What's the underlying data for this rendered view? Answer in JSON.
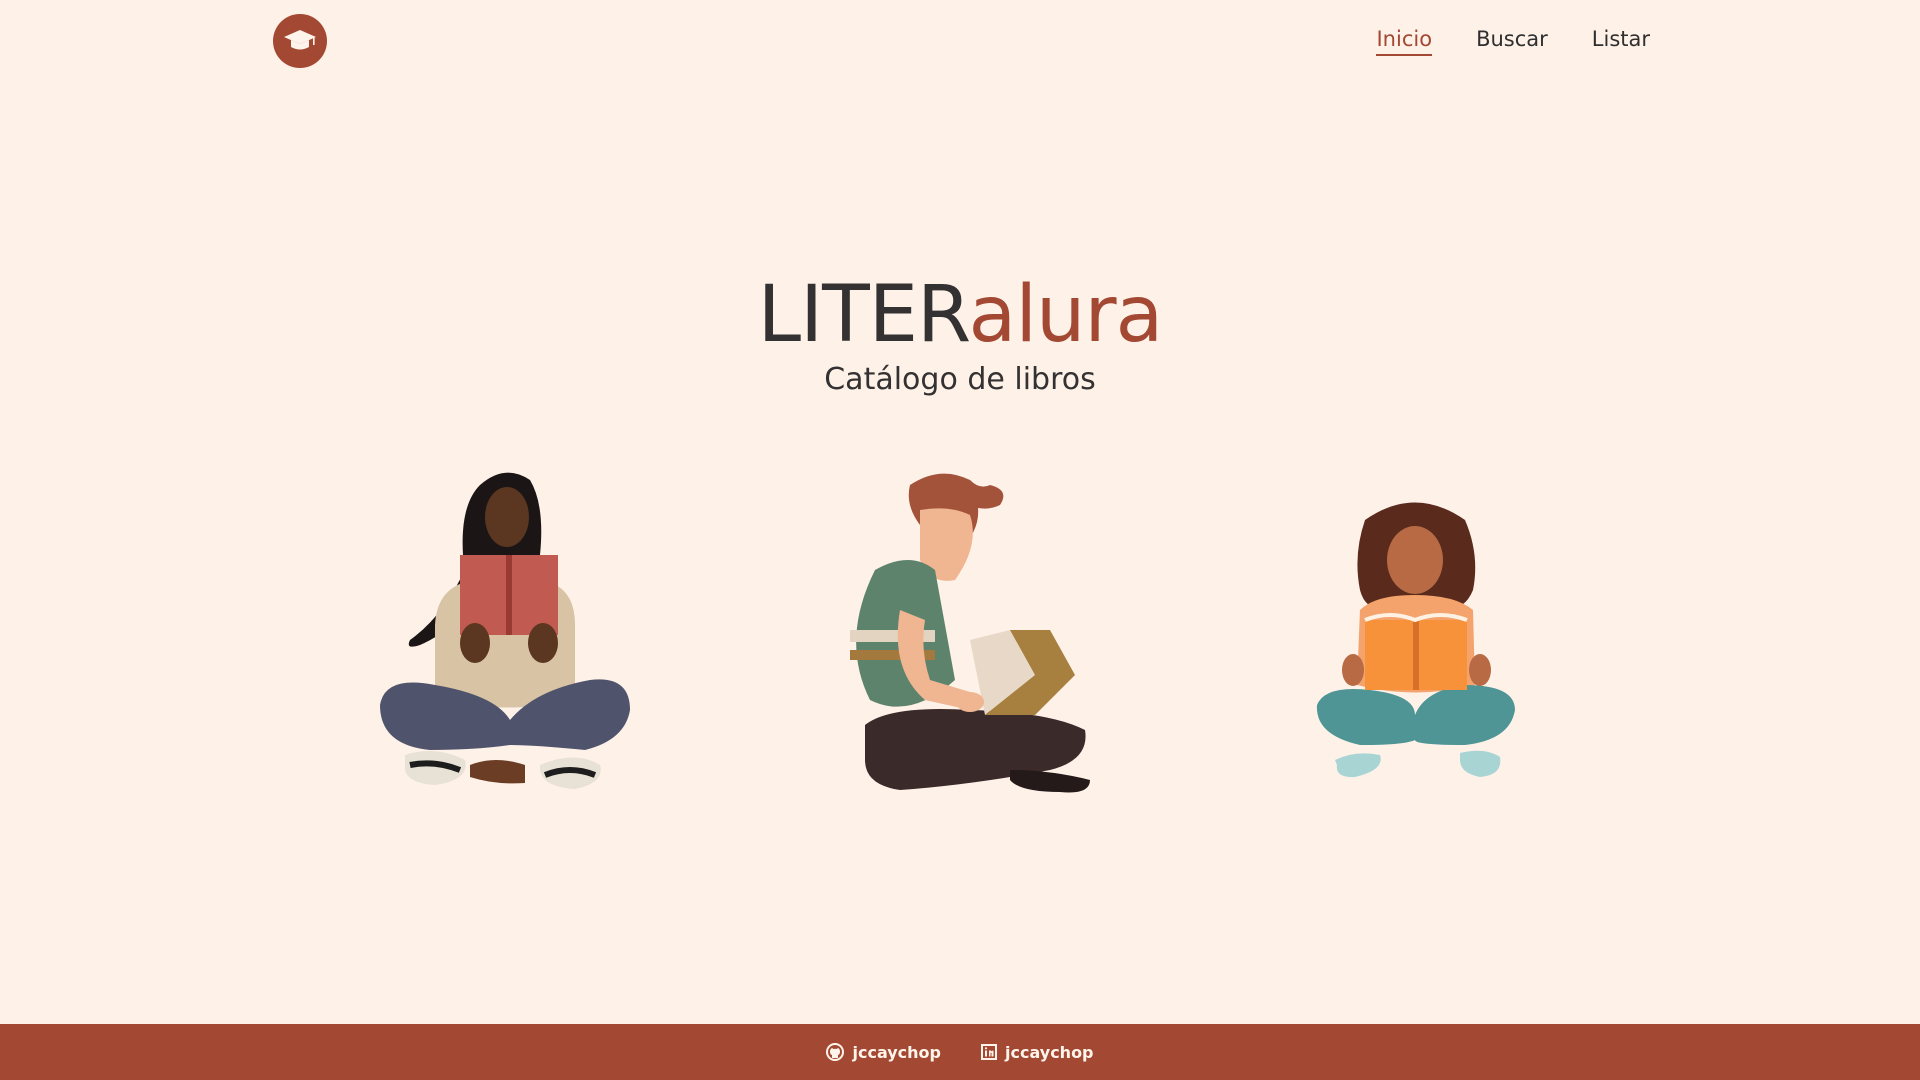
{
  "nav": {
    "items": [
      {
        "label": "Inicio",
        "active": true
      },
      {
        "label": "Buscar",
        "active": false
      },
      {
        "label": "Listar",
        "active": false
      }
    ]
  },
  "hero": {
    "brand_dark": "LITER",
    "brand_accent": "alura",
    "subtitle": "Catálogo de libros"
  },
  "footer": {
    "github": "jccaychop",
    "linkedin": "jccaychop"
  },
  "icons": {
    "logo": "graduation-cap-icon",
    "github": "github-icon",
    "linkedin": "linkedin-icon"
  },
  "colors": {
    "background": "#fef1e8",
    "accent": "#a34832",
    "text": "#333131"
  }
}
